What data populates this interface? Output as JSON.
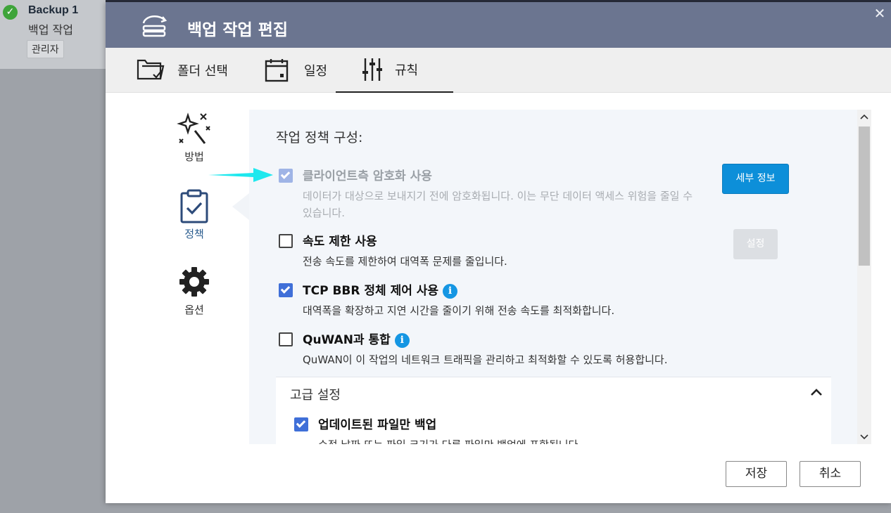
{
  "background_app": {
    "task_title": "Backup 1",
    "task_subtitle": "백업 작업",
    "badge": "관리자"
  },
  "dialog": {
    "title": "백업 작업 편집",
    "close_icon": "close-icon",
    "tabs": [
      {
        "label": "폴더 선택",
        "icon": "folder-select-icon"
      },
      {
        "label": "일정",
        "icon": "calendar-icon"
      },
      {
        "label": "규칙",
        "icon": "sliders-icon",
        "active": true
      }
    ],
    "sidenav": [
      {
        "label": "방법",
        "icon": "magic-wand-icon"
      },
      {
        "label": "정책",
        "icon": "clipboard-check-icon",
        "active": true
      },
      {
        "label": "옵션",
        "icon": "gear-icon"
      }
    ],
    "section_title": "작업 정책 구성:",
    "options": [
      {
        "title": "클라이언트측 암호화 사용",
        "desc": "데이터가 대상으로 보내지기 전에 암호화됩니다. 이는 무단 데이터 액세스 위험을 줄일 수 있습니다.",
        "checked": true,
        "disabled": true,
        "button": "세부 정보"
      },
      {
        "title": "속도 제한 사용",
        "desc": "전송 속도를 제한하여 대역폭 문제를 줄입니다.",
        "checked": false,
        "button": "설정"
      },
      {
        "title": "TCP BBR 정체 제어 사용",
        "desc": "대역폭을 확장하고 지연 시간을 줄이기 위해 전송 속도를 최적화합니다.",
        "checked": true,
        "info": "i"
      },
      {
        "title": "QuWAN과 통합",
        "desc": "QuWAN이 이 작업의 네트워크 트래픽을 관리하고 최적화할 수 있도록 허용합니다.",
        "checked": false,
        "info": "i"
      }
    ],
    "advanced": {
      "title": "고급 설정",
      "option_title": "업데이트된 파일만 백업",
      "option_desc": "수정 날짜 또는 파일 크기가 다른 파일만 백업에 포함됩니다.",
      "checked": true
    },
    "footer": {
      "save": "저장",
      "cancel": "취소"
    }
  },
  "colors": {
    "header_bg": "#6b7590",
    "primary_button": "#0d8fd9",
    "checkbox_checked": "#3f6fd8",
    "info_icon": "#1596e3",
    "annotation_arrow": "#1ee8ee"
  }
}
